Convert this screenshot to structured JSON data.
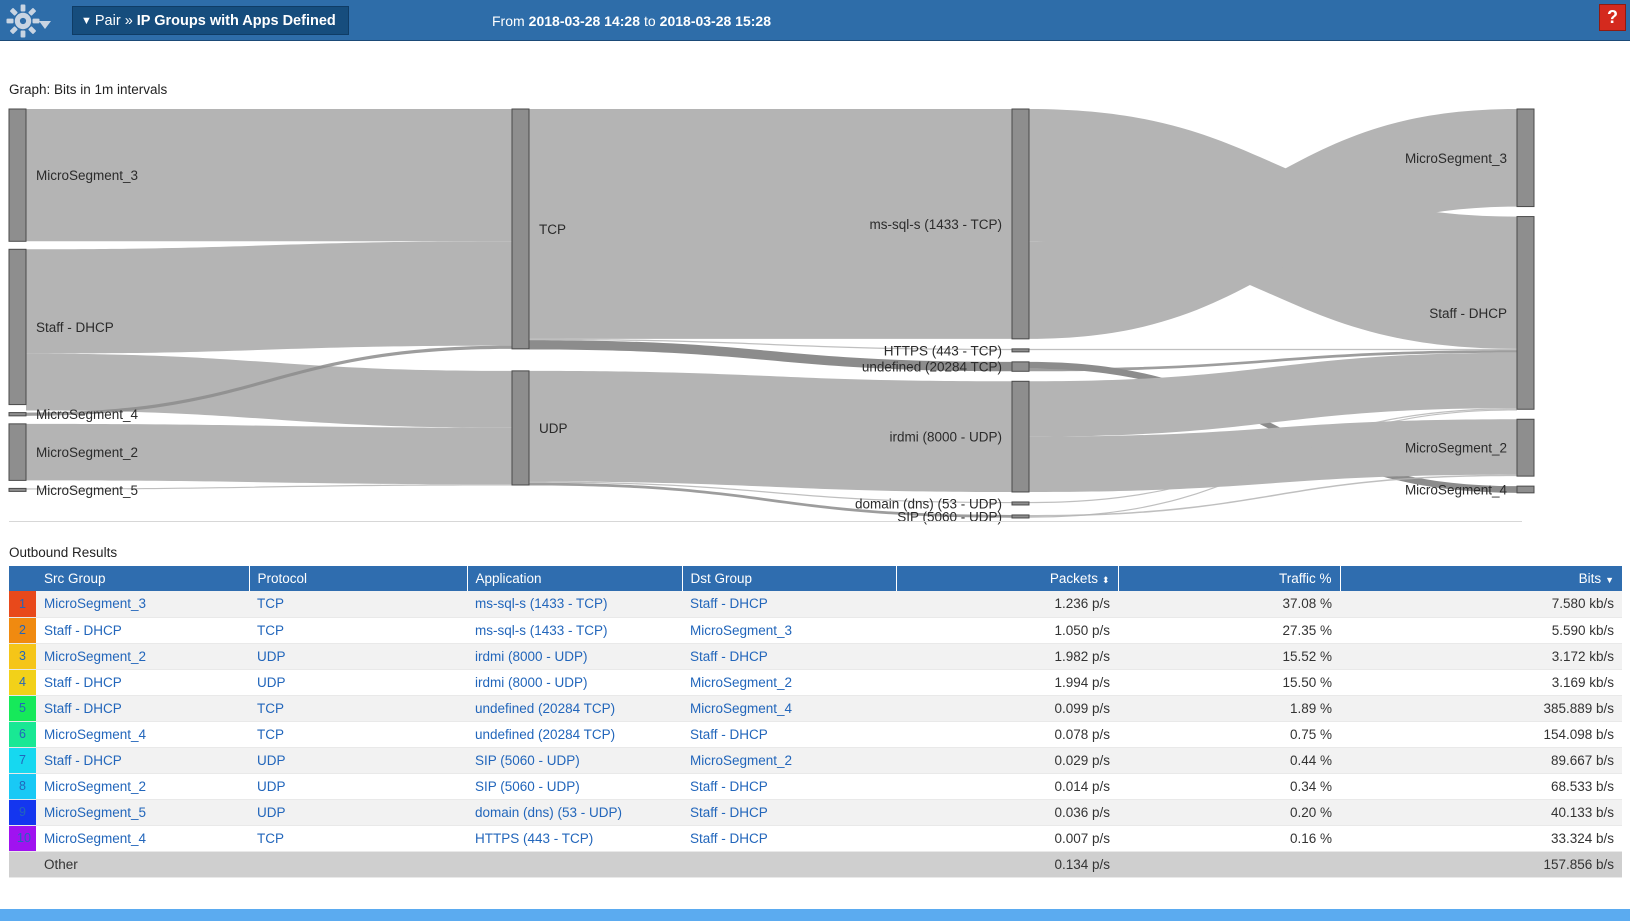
{
  "header": {
    "gear_icon": "gear-icon",
    "breadcrumb": {
      "caret": "▼",
      "root": "Pair",
      "separator": "»",
      "leaf": "IP Groups with Apps Defined"
    },
    "timerange": {
      "from_label": "From",
      "from_value": "2018-03-28 14:28",
      "to_label": "to",
      "to_value": "2018-03-28 15:28"
    },
    "help_label": "?",
    "accent_color": "#2e6da9",
    "breadcrumb_color": "#164d7d",
    "help_color": "#d42a1e"
  },
  "graph": {
    "title": "Graph: Bits in 1m intervals"
  },
  "results": {
    "title": "Outbound Results",
    "columns": [
      {
        "label": "Src Group",
        "align": "left"
      },
      {
        "label": "Protocol",
        "align": "left"
      },
      {
        "label": "Application",
        "align": "left"
      },
      {
        "label": "Dst Group",
        "align": "left"
      },
      {
        "label": "Packets",
        "align": "right",
        "sort": "both"
      },
      {
        "label": "Traffic %",
        "align": "right"
      },
      {
        "label": "Bits",
        "align": "right",
        "sort": "desc"
      }
    ],
    "rows": [
      {
        "n": "1",
        "color": "#e8491b",
        "src": "MicroSegment_3",
        "proto": "TCP",
        "app": "ms-sql-s (1433 - TCP)",
        "dst": "Staff - DHCP",
        "packets": "1.236 p/s",
        "traffic": "37.08 %",
        "bits": "7.580 kb/s"
      },
      {
        "n": "2",
        "color": "#f08a10",
        "src": "Staff - DHCP",
        "proto": "TCP",
        "app": "ms-sql-s (1433 - TCP)",
        "dst": "MicroSegment_3",
        "packets": "1.050 p/s",
        "traffic": "27.35 %",
        "bits": "5.590 kb/s"
      },
      {
        "n": "3",
        "color": "#f5c518",
        "src": "MicroSegment_2",
        "proto": "UDP",
        "app": "irdmi (8000 - UDP)",
        "dst": "Staff - DHCP",
        "packets": "1.982 p/s",
        "traffic": "15.52 %",
        "bits": "3.172 kb/s"
      },
      {
        "n": "4",
        "color": "#f2d119",
        "src": "Staff - DHCP",
        "proto": "UDP",
        "app": "irdmi (8000 - UDP)",
        "dst": "MicroSegment_2",
        "packets": "1.994 p/s",
        "traffic": "15.50 %",
        "bits": "3.169 kb/s"
      },
      {
        "n": "5",
        "color": "#16e95a",
        "src": "Staff - DHCP",
        "proto": "TCP",
        "app": "undefined (20284 TCP)",
        "dst": "MicroSegment_4",
        "packets": "0.099 p/s",
        "traffic": "1.89 %",
        "bits": "385.889 b/s"
      },
      {
        "n": "6",
        "color": "#19e894",
        "src": "MicroSegment_4",
        "proto": "TCP",
        "app": "undefined (20284 TCP)",
        "dst": "Staff - DHCP",
        "packets": "0.078 p/s",
        "traffic": "0.75 %",
        "bits": "154.098 b/s"
      },
      {
        "n": "7",
        "color": "#16d8f0",
        "src": "Staff - DHCP",
        "proto": "UDP",
        "app": "SIP (5060 - UDP)",
        "dst": "MicroSegment_2",
        "packets": "0.029 p/s",
        "traffic": "0.44 %",
        "bits": "89.667 b/s"
      },
      {
        "n": "8",
        "color": "#19c9f5",
        "src": "MicroSegment_2",
        "proto": "UDP",
        "app": "SIP (5060 - UDP)",
        "dst": "Staff - DHCP",
        "packets": "0.014 p/s",
        "traffic": "0.34 %",
        "bits": "68.533 b/s"
      },
      {
        "n": "9",
        "color": "#1436ef",
        "src": "MicroSegment_5",
        "proto": "UDP",
        "app": "domain (dns) (53 - UDP)",
        "dst": "Staff - DHCP",
        "packets": "0.036 p/s",
        "traffic": "0.20 %",
        "bits": "40.133 b/s"
      },
      {
        "n": "10",
        "color": "#a012f0",
        "src": "MicroSegment_4",
        "proto": "TCP",
        "app": "HTTPS (443 - TCP)",
        "dst": "Staff - DHCP",
        "packets": "0.007 p/s",
        "traffic": "0.16 %",
        "bits": "33.324 b/s"
      }
    ],
    "other": {
      "label": "Other",
      "packets": "0.134 p/s",
      "traffic": "",
      "bits": "157.856 b/s"
    }
  },
  "chart_data": {
    "type": "sankey",
    "title": "Graph: Bits in 1m intervals",
    "columns": [
      "Src Group",
      "Protocol",
      "Application",
      "Dst Group"
    ],
    "nodes": [
      {
        "id": "src_ms3",
        "column": 0,
        "label": "MicroSegment_3",
        "label_side": "right",
        "value": 7580
      },
      {
        "id": "src_staff",
        "column": 0,
        "label": "Staff - DHCP",
        "label_side": "right",
        "value": 8897
      },
      {
        "id": "src_ms4",
        "column": 0,
        "label": "MicroSegment_4",
        "label_side": "right",
        "value": 187
      },
      {
        "id": "src_ms2",
        "column": 0,
        "label": "MicroSegment_2",
        "label_side": "right",
        "value": 3240
      },
      {
        "id": "src_ms5",
        "column": 0,
        "label": "MicroSegment_5",
        "label_side": "right",
        "value": 40
      },
      {
        "id": "proto_tcp",
        "column": 1,
        "label": "TCP",
        "label_side": "right",
        "value": 13743
      },
      {
        "id": "proto_udp",
        "column": 1,
        "label": "UDP",
        "label_side": "right",
        "value": 6539
      },
      {
        "id": "app_mssql",
        "column": 2,
        "label": "ms-sql-s (1433 - TCP)",
        "label_side": "left",
        "value": 13170
      },
      {
        "id": "app_https",
        "column": 2,
        "label": "HTTPS (443 - TCP)",
        "label_side": "left",
        "value": 33
      },
      {
        "id": "app_undef",
        "column": 2,
        "label": "undefined (20284 TCP)",
        "label_side": "left",
        "value": 540
      },
      {
        "id": "app_irdmi",
        "column": 2,
        "label": "irdmi (8000 - UDP)",
        "label_side": "left",
        "value": 6341
      },
      {
        "id": "app_dns",
        "column": 2,
        "label": "domain (dns) (53 - UDP)",
        "label_side": "left",
        "value": 40
      },
      {
        "id": "app_sip",
        "column": 2,
        "label": "SIP (5060 - UDP)",
        "label_side": "left",
        "value": 158
      },
      {
        "id": "dst_ms3",
        "column": 3,
        "label": "MicroSegment_3",
        "label_side": "left",
        "value": 5590
      },
      {
        "id": "dst_staff",
        "column": 3,
        "label": "Staff - DHCP",
        "label_side": "left",
        "value": 11040
      },
      {
        "id": "dst_ms2",
        "column": 3,
        "label": "MicroSegment_2",
        "label_side": "left",
        "value": 3258
      },
      {
        "id": "dst_ms4",
        "column": 3,
        "label": "MicroSegment_4",
        "label_side": "left",
        "value": 386
      }
    ],
    "links": [
      {
        "source": "src_ms3",
        "target": "proto_tcp",
        "value": 7580
      },
      {
        "source": "src_staff",
        "target": "proto_tcp",
        "value": 5976
      },
      {
        "source": "src_staff",
        "target": "proto_udp",
        "value": 3259
      },
      {
        "source": "src_ms4",
        "target": "proto_tcp",
        "value": 187
      },
      {
        "source": "src_ms2",
        "target": "proto_udp",
        "value": 3240
      },
      {
        "source": "src_ms5",
        "target": "proto_udp",
        "value": 40
      },
      {
        "source": "proto_tcp",
        "target": "app_mssql",
        "value": 13170
      },
      {
        "source": "proto_tcp",
        "target": "app_https",
        "value": 33
      },
      {
        "source": "proto_tcp",
        "target": "app_undef",
        "value": 540
      },
      {
        "source": "proto_udp",
        "target": "app_irdmi",
        "value": 6341
      },
      {
        "source": "proto_udp",
        "target": "app_dns",
        "value": 40
      },
      {
        "source": "proto_udp",
        "target": "app_sip",
        "value": 158
      },
      {
        "source": "app_mssql",
        "target": "dst_staff",
        "value": 7580
      },
      {
        "source": "app_mssql",
        "target": "dst_ms3",
        "value": 5590
      },
      {
        "source": "app_https",
        "target": "dst_staff",
        "value": 33
      },
      {
        "source": "app_undef",
        "target": "dst_ms4",
        "value": 386
      },
      {
        "source": "app_undef",
        "target": "dst_staff",
        "value": 154
      },
      {
        "source": "app_irdmi",
        "target": "dst_staff",
        "value": 3172
      },
      {
        "source": "app_irdmi",
        "target": "dst_ms2",
        "value": 3169
      },
      {
        "source": "app_dns",
        "target": "dst_staff",
        "value": 40
      },
      {
        "source": "app_sip",
        "target": "dst_ms2",
        "value": 89
      },
      {
        "source": "app_sip",
        "target": "dst_staff",
        "value": 68
      }
    ]
  }
}
